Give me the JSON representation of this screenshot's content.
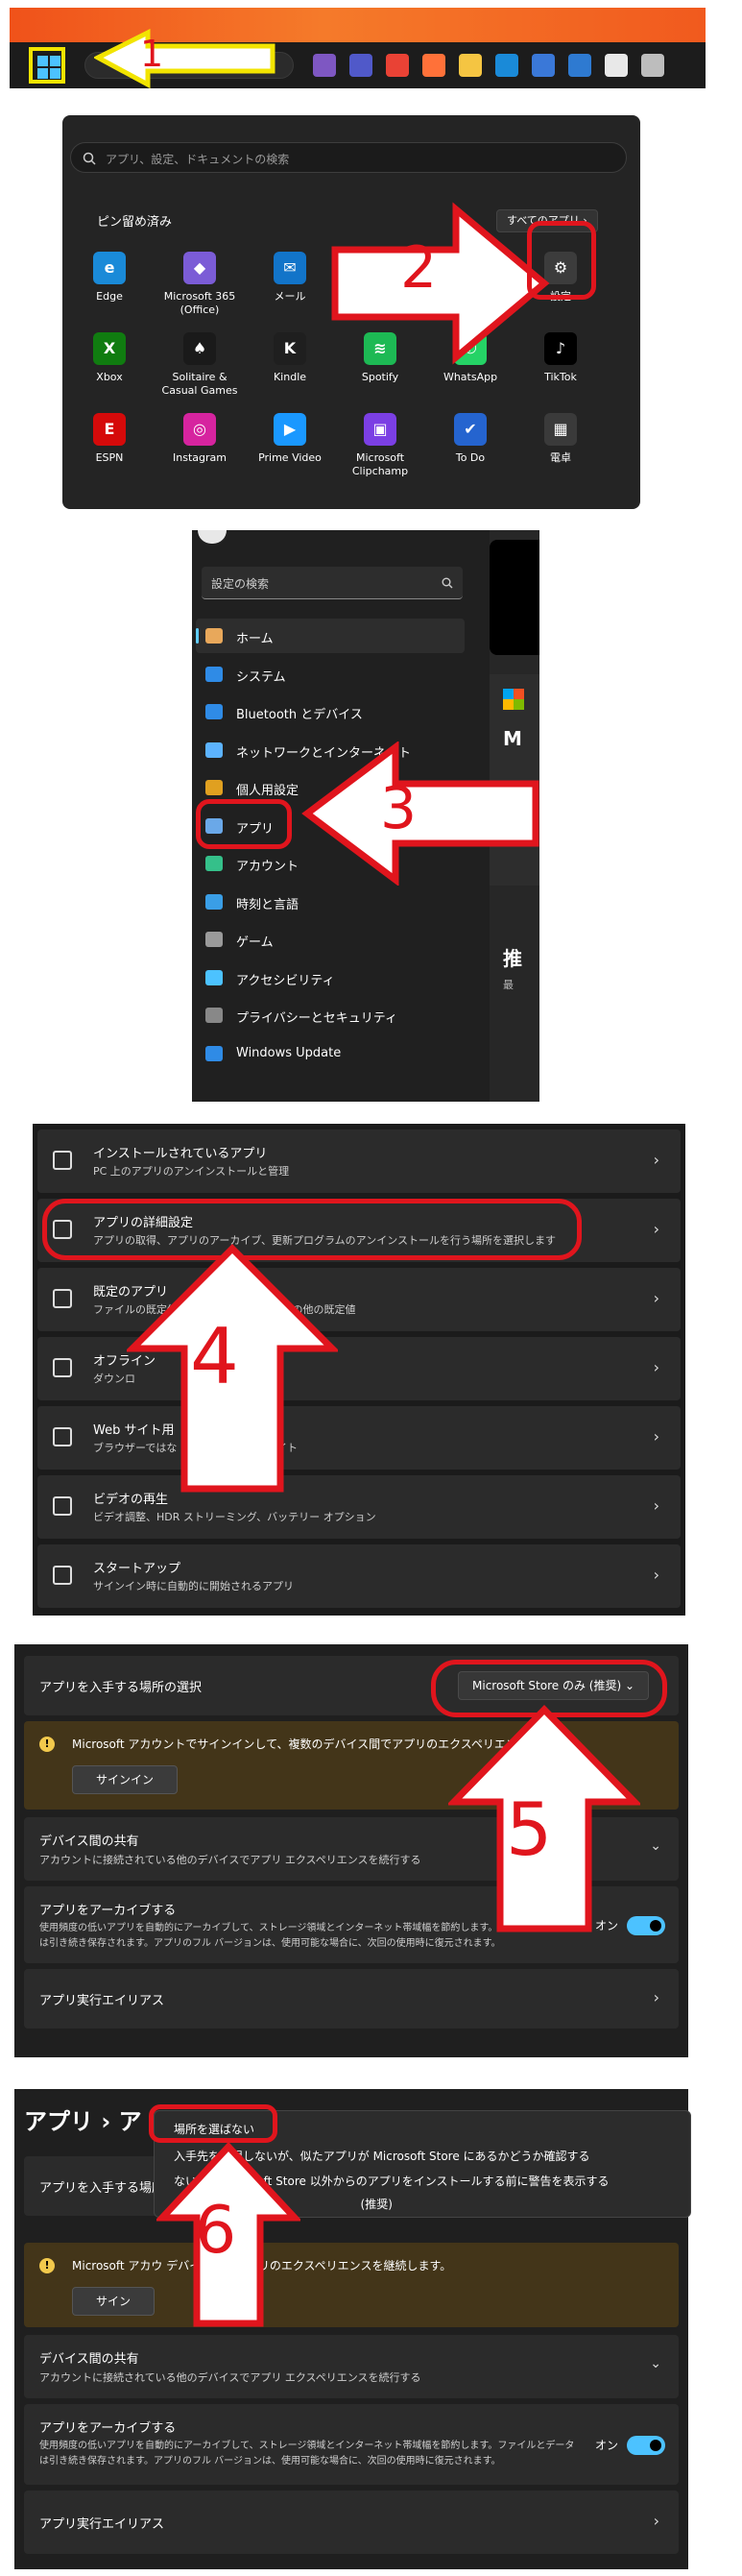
{
  "panel1": {
    "step": "1",
    "taskbar_icons": [
      "copilot-icon",
      "teams-icon",
      "chrome-icon",
      "firefox-icon",
      "file-explorer-icon",
      "edge-icon",
      "notepad-icon",
      "defender-icon",
      "file-icon",
      "settings-icon"
    ]
  },
  "panel2": {
    "step": "2",
    "search_placeholder": "アプリ、設定、ドキュメントの検索",
    "pinned_title": "ピン留め済み",
    "all_apps": "すべてのアプリ  ›",
    "apps": [
      {
        "label": "Edge",
        "color": "#1a8ad8",
        "glyph": "e"
      },
      {
        "label": "Microsoft 365 (Office)",
        "color": "#7b5cd6",
        "glyph": "◆"
      },
      {
        "label": "メール",
        "color": "#1274c9",
        "glyph": "✉"
      },
      {
        "label": "",
        "color": "#242424",
        "glyph": ""
      },
      {
        "label": "",
        "color": "#242424",
        "glyph": ""
      },
      {
        "label": "設定",
        "color": "#3c3c3c",
        "glyph": "⚙"
      },
      {
        "label": "Xbox",
        "color": "#107c10",
        "glyph": "X"
      },
      {
        "label": "Solitaire & Casual Games",
        "color": "#1a1a1a",
        "glyph": "♠"
      },
      {
        "label": "Kindle",
        "color": "#1f1f1f",
        "glyph": "K"
      },
      {
        "label": "Spotify",
        "color": "#1db954",
        "glyph": "≋"
      },
      {
        "label": "WhatsApp",
        "color": "#25d366",
        "glyph": "✆"
      },
      {
        "label": "TikTok",
        "color": "#000000",
        "glyph": "♪"
      },
      {
        "label": "ESPN",
        "color": "#d50a0a",
        "glyph": "E"
      },
      {
        "label": "Instagram",
        "color": "#d6249f",
        "glyph": "◎"
      },
      {
        "label": "Prime Video",
        "color": "#1a98ff",
        "glyph": "▶"
      },
      {
        "label": "Microsoft Clipchamp",
        "color": "#7b3fe4",
        "glyph": "▣"
      },
      {
        "label": "To Do",
        "color": "#2564cf",
        "glyph": "✔"
      },
      {
        "label": "電卓",
        "color": "#3a3a3a",
        "glyph": "▦"
      }
    ]
  },
  "panel3": {
    "step": "3",
    "search_placeholder": "設定の検索",
    "nav": [
      {
        "label": "ホーム",
        "color": "#e8a85b"
      },
      {
        "label": "システム",
        "color": "#2f8be6"
      },
      {
        "label": "Bluetooth とデバイス",
        "color": "#2f8be6"
      },
      {
        "label": "ネットワークとインターネット",
        "color": "#5cb3ff"
      },
      {
        "label": "個人用設定",
        "color": "#e0a020"
      },
      {
        "label": "アプリ",
        "color": "#6aa8e8"
      },
      {
        "label": "アカウント",
        "color": "#35c08a"
      },
      {
        "label": "時刻と言語",
        "color": "#3a9ee6"
      },
      {
        "label": "ゲーム",
        "color": "#9a9a9a"
      },
      {
        "label": "アクセシビリティ",
        "color": "#4cc2ff"
      },
      {
        "label": "プライバシーとセキュリティ",
        "color": "#888888"
      },
      {
        "label": "Windows Update",
        "color": "#2f8be6"
      }
    ],
    "right_fragments": [
      "M",
      "推",
      "最"
    ]
  },
  "panel4": {
    "step": "4",
    "rows": [
      {
        "title": "インストールされているアプリ",
        "sub": "PC 上のアプリのアンインストールと管理"
      },
      {
        "title": "アプリの詳細設定",
        "sub": "アプリの取得、アプリのアーカイブ、更新プログラムのアンインストールを行う場所を選択します"
      },
      {
        "title": "既定のアプリ",
        "sub": "ファイルの既定値、リンク         種類、その他の既定値"
      },
      {
        "title": "オフライン",
        "sub": "ダウンロ"
      },
      {
        "title": "Web サイト用",
        "sub": "ブラウザーではな                   web サイト"
      },
      {
        "title": "ビデオの再生",
        "sub": "ビデオ調整、HDR ストリーミング、バッテリー オプション"
      },
      {
        "title": "スタートアップ",
        "sub": "サインイン時に自動的に開始されるアプリ"
      }
    ]
  },
  "panel5": {
    "step": "5",
    "choose_title": "アプリを入手する場所の選択",
    "dropdown": "Microsoft Store のみ (推奨)  ⌄",
    "warning": "Microsoft アカウントでサインインして、複数のデバイス間でアプリのエクスペリエンスを継続",
    "signin": "サインイン",
    "share_title": "デバイス間の共有",
    "share_sub": "アカウントに接続されている他のデバイスでアプリ エクスペリエンスを続行する",
    "archive_title": "アプリをアーカイブする",
    "archive_sub1": "使用頻度の低いアプリを自動的にアーカイブして、ストレージ領域とインターネット帯域幅を節約します。ファイルとデータ",
    "archive_sub2": "は引き続き保存されます。アプリのフル バージョンは、使用可能な場合に、次回の使用時に復元されます。",
    "archive_state": "オン",
    "alias_title": "アプリ実行エイリアス"
  },
  "panel6": {
    "step": "6",
    "breadcrumb": "アプリ  ›  ア",
    "menu_items": [
      "場所を選ばない",
      "入手先を制限しないが、似たアプリが Microsoft Store にあるかどうか確認する",
      "                 ないが、Microsoft Store 以外からのアプリをインストールする前に警告を表示する",
      "                                                   (推奨)"
    ],
    "choose_title": "アプリを入手する場所",
    "warning": "Microsoft アカウ                      デバイス間でアプリのエクスペリエンスを継続します。",
    "signin": "サイン",
    "share_title": "デバイス間の共有",
    "share_sub": "アカウントに接続されている他のデバイスでアプリ エクスペリエンスを続行する",
    "archive_title": "アプリをアーカイブする",
    "archive_sub1": "使用頻度の低いアプリを自動的にアーカイブして、ストレージ領域とインターネット帯域幅を節約します。ファイルとデータ",
    "archive_sub2": "は引き続き保存されます。アプリのフル バージョンは、使用可能な場合に、次回の使用時に復元されます。",
    "archive_state": "オン",
    "alias_title": "アプリ実行エイリアス"
  }
}
